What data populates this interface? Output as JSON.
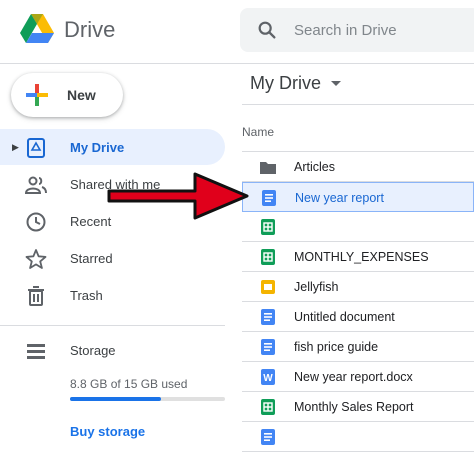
{
  "header": {
    "brand": "Drive",
    "search_placeholder": "Search in Drive"
  },
  "new_button": {
    "label": "New"
  },
  "sidebar": {
    "items": [
      {
        "label": "My Drive",
        "icon": "my-drive-icon",
        "active": true
      },
      {
        "label": "Shared with me",
        "icon": "people-icon",
        "active": false
      },
      {
        "label": "Recent",
        "icon": "clock-icon",
        "active": false
      },
      {
        "label": "Starred",
        "icon": "star-icon",
        "active": false
      },
      {
        "label": "Trash",
        "icon": "trash-icon",
        "active": false
      }
    ],
    "storage": {
      "label": "Storage",
      "used_text": "8.8 GB of 15 GB used",
      "used_fraction": 0.587,
      "buy_label": "Buy storage"
    }
  },
  "main": {
    "title": "My Drive",
    "column_header": "Name",
    "files": [
      {
        "name": "Articles",
        "type": "folder"
      },
      {
        "name": "New year report",
        "type": "doc",
        "selected": true
      },
      {
        "name": "",
        "type": "sheet"
      },
      {
        "name": "MONTHLY_EXPENSES",
        "type": "sheet"
      },
      {
        "name": "Jellyfish",
        "type": "slides"
      },
      {
        "name": "Untitled document",
        "type": "doc"
      },
      {
        "name": "fish price guide",
        "type": "doc"
      },
      {
        "name": "New year report.docx",
        "type": "word"
      },
      {
        "name": "Monthly Sales Report",
        "type": "sheet"
      },
      {
        "name": "",
        "type": "doc"
      }
    ]
  },
  "colors": {
    "accent": "#1a73e8",
    "selection_bg": "#e8f0fe",
    "annotation_arrow": "#e0001b",
    "doc": "#4285f4",
    "sheet": "#0f9d58",
    "slides": "#f4b400",
    "folder": "#5f6368"
  }
}
